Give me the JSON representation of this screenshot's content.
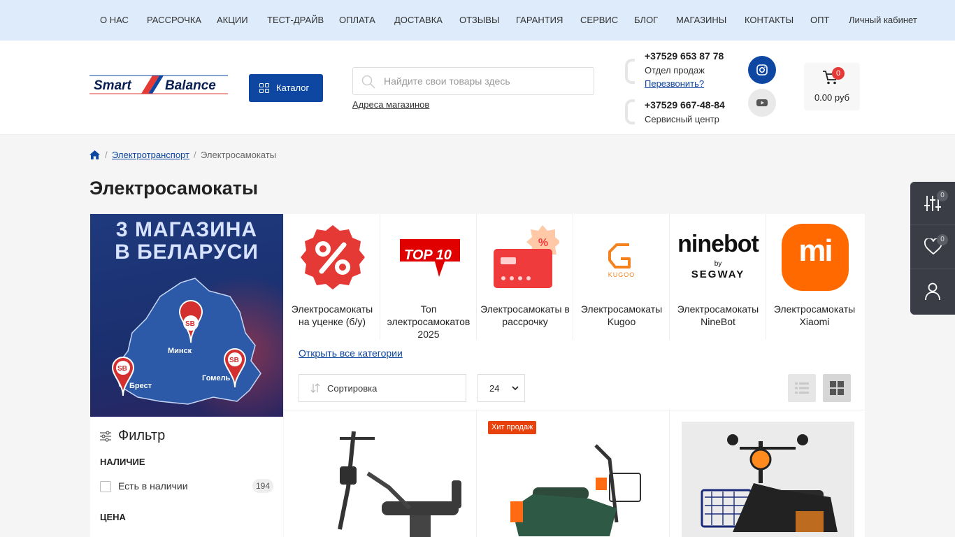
{
  "topnav": {
    "items": [
      "О НАС",
      "РАССРОЧКА",
      "АКЦИИ",
      "ТЕСТ-ДРАЙВ",
      "ОПЛАТА",
      "ДОСТАВКА",
      "ОТЗЫВЫ",
      "ГАРАНТИЯ",
      "СЕРВИС",
      "БЛОГ",
      "МАГАЗИНЫ",
      "КОНТАКТЫ",
      "ОПТ"
    ],
    "account": "Личный кабинет"
  },
  "header": {
    "logo_text": "Smart Balance",
    "catalog_label": "Каталог",
    "search_placeholder": "Найдите свои товары здесь",
    "stores_link": "Адреса магазинов",
    "phone1": "+37529 653 87 78",
    "phone1_label": "Отдел продаж",
    "callback": "Перезвонить?",
    "phone2": "+37529 667-48-84",
    "phone2_label": "Сервисный центр",
    "cart_count": "0",
    "cart_total": "0.00 руб",
    "social": [
      "instagram-icon",
      "youtube-icon"
    ]
  },
  "breadcrumb": {
    "items": [
      "Электротранспорт",
      "Электросамокаты"
    ]
  },
  "page_title": "Электросамокаты",
  "promo": {
    "line1": "3 МАГАЗИНА",
    "line2": "В БЕЛАРУСИ",
    "cities": [
      "Минск",
      "Брест",
      "Гомель"
    ],
    "pin_label": "SB"
  },
  "filter": {
    "title": "Фильтр",
    "availability_title": "НАЛИЧИЕ",
    "in_stock_label": "Есть в наличии",
    "in_stock_count": "194",
    "price_title": "ЦЕНА"
  },
  "categories": [
    {
      "label": "Электросамокаты на уценке (б/у)",
      "icon": "discount-icon"
    },
    {
      "label": "Топ электросамокатов 2025",
      "icon": "top10-icon",
      "icon_text": "TOP 10"
    },
    {
      "label": "Электросамокаты в рассрочку",
      "icon": "installment-card-icon"
    },
    {
      "label": "Электросамокаты Kugoo",
      "icon": "kugoo-logo-icon",
      "icon_text": "KUGOO"
    },
    {
      "label": "Электросамокаты NineBot",
      "icon": "ninebot-logo-icon",
      "icon_text": "ninebot",
      "icon_sub": "by",
      "icon_brand": "SEGWAY"
    },
    {
      "label": "Электросамокаты Xiaomi",
      "icon": "xiaomi-logo-icon",
      "icon_text": "mi"
    }
  ],
  "listing": {
    "open_all": "Открыть все категории",
    "sort_label": "Сортировка",
    "per_page": "24"
  },
  "products": [
    {
      "badge": ""
    },
    {
      "badge": "Хит продаж"
    },
    {
      "badge": ""
    }
  ],
  "sidetools": {
    "compare_count": "0",
    "favorites_count": "0"
  },
  "colors": {
    "topnav_bg": "#ddebfb",
    "brand_blue": "#0d47a1",
    "accent_red": "#e53935",
    "hit_orange": "#e8420c"
  }
}
